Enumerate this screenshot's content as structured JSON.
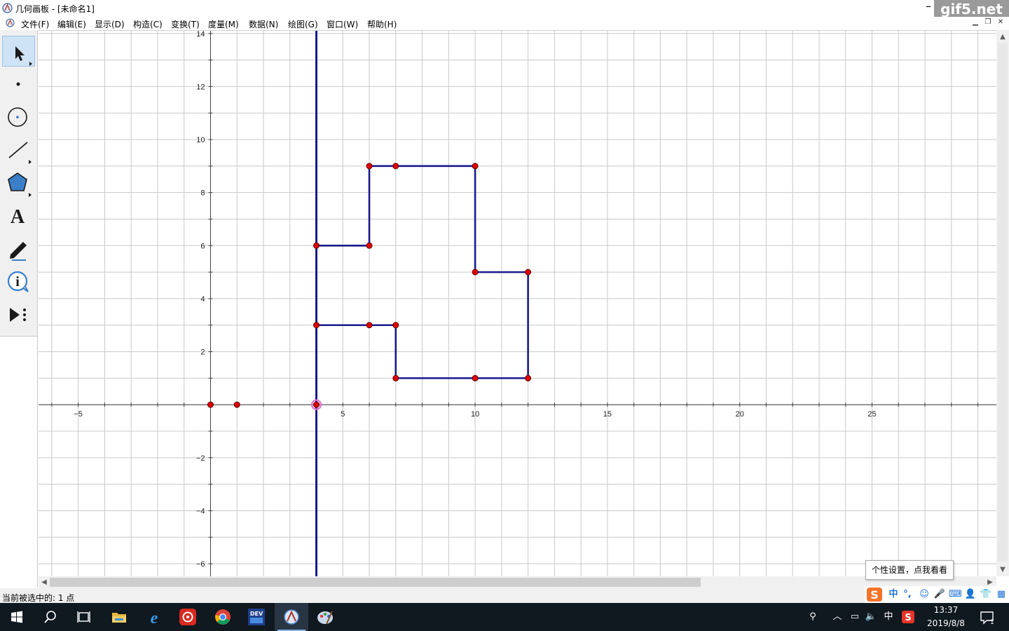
{
  "window": {
    "title": "几何画板 - [未命名1]",
    "watermark": "gif5.net"
  },
  "menu": [
    {
      "label": "文件(F)"
    },
    {
      "label": "编辑(E)"
    },
    {
      "label": "显示(D)"
    },
    {
      "label": "构造(C)"
    },
    {
      "label": "变换(T)"
    },
    {
      "label": "度量(M)"
    },
    {
      "label": "数据(N)"
    },
    {
      "label": "绘图(G)"
    },
    {
      "label": "窗口(W)"
    },
    {
      "label": "帮助(H)"
    }
  ],
  "tools": [
    {
      "name": "selection-arrow-tool",
      "active": true
    },
    {
      "name": "point-tool"
    },
    {
      "name": "compass-tool"
    },
    {
      "name": "straightedge-tool"
    },
    {
      "name": "polygon-tool"
    },
    {
      "name": "text-tool"
    },
    {
      "name": "marker-tool"
    },
    {
      "name": "information-tool"
    },
    {
      "name": "custom-tool"
    }
  ],
  "chart_data": {
    "type": "scatter",
    "title": "",
    "xlabel": "",
    "ylabel": "",
    "xlim": [
      -6.5,
      29.7
    ],
    "ylim": [
      -6.5,
      14.1
    ],
    "grid": true,
    "x_ticks": [
      -5,
      5,
      10,
      15,
      20,
      25
    ],
    "y_ticks": [
      -6,
      -4,
      -2,
      2,
      4,
      6,
      8,
      10,
      12,
      14
    ],
    "vertical_line": {
      "x": 4,
      "color": "#1a1a8c"
    },
    "polygon": {
      "color": "#1a1a8c",
      "vertices": [
        [
          4,
          6
        ],
        [
          6,
          6
        ],
        [
          6,
          9
        ],
        [
          10,
          9
        ],
        [
          10,
          5
        ],
        [
          12,
          5
        ],
        [
          12,
          1
        ],
        [
          7,
          1
        ],
        [
          7,
          3
        ],
        [
          4,
          3
        ]
      ]
    },
    "inner_segment": {
      "from": [
        4,
        3
      ],
      "to": [
        7,
        3
      ]
    },
    "points": [
      {
        "x": 0,
        "y": 0
      },
      {
        "x": 1,
        "y": 0
      },
      {
        "x": 4,
        "y": 0,
        "selected": true
      },
      {
        "x": 4,
        "y": 6
      },
      {
        "x": 6,
        "y": 6
      },
      {
        "x": 6,
        "y": 9
      },
      {
        "x": 7,
        "y": 9
      },
      {
        "x": 10,
        "y": 9
      },
      {
        "x": 10,
        "y": 5
      },
      {
        "x": 12,
        "y": 5
      },
      {
        "x": 12,
        "y": 1
      },
      {
        "x": 10,
        "y": 1
      },
      {
        "x": 7,
        "y": 1
      },
      {
        "x": 7,
        "y": 3
      },
      {
        "x": 6,
        "y": 3
      },
      {
        "x": 4,
        "y": 3
      }
    ],
    "point_color": "#e00000"
  },
  "status": {
    "text": "当前被选中的: 1 点"
  },
  "ime": {
    "tooltip": "个性设置，点我看看",
    "mode": "中"
  },
  "taskbar": {
    "apps": [
      "windows-start",
      "search",
      "task-view",
      "file-explorer",
      "edge",
      "netease-music",
      "chrome",
      "dev-cpp",
      "geometers-sketchpad",
      "paint-app"
    ],
    "tray_lang": "中",
    "time": "13:37",
    "date": "2019/8/8",
    "notifications": "1"
  }
}
